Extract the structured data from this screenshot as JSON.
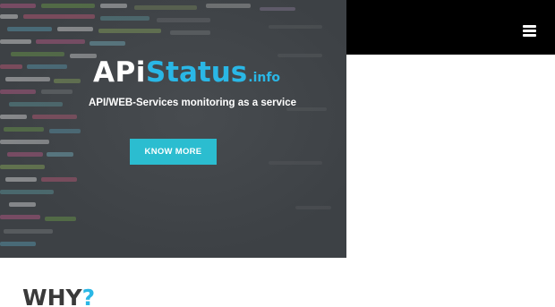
{
  "hero": {
    "logo_main": "APi",
    "logo_accent": "Status",
    "logo_suffix": ".info",
    "tagline": "API/WEB-Services monitoring as a service",
    "cta_label": "KNOW MORE"
  },
  "header": {
    "menu_icon": "hamburger-menu-icon"
  },
  "section_why": {
    "heading": "WHY",
    "heading_mark": "?"
  },
  "colors": {
    "accent": "#2ab7e6",
    "button": "#2bbdd0",
    "topbar": "#000000",
    "heading": "#3a3a3a"
  }
}
